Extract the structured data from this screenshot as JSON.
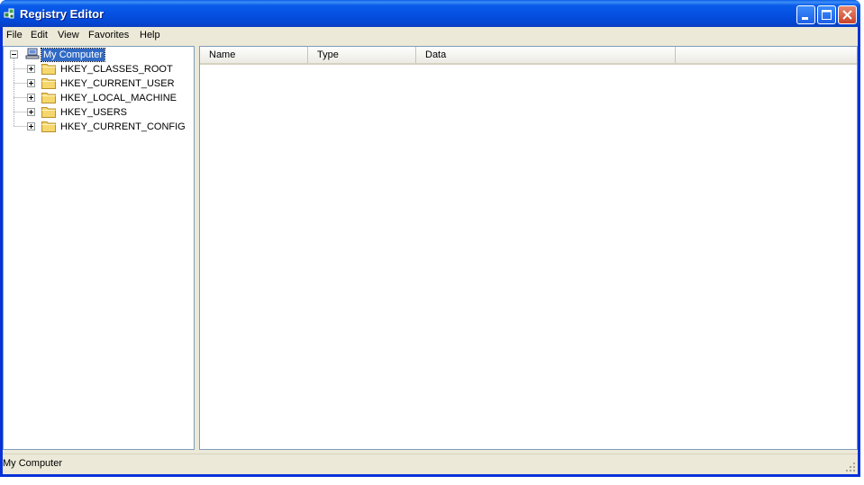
{
  "window": {
    "title": "Registry Editor",
    "icon": "registry-editor-icon",
    "controls": [
      "minimize-icon",
      "maximize-icon",
      "close-icon"
    ]
  },
  "menu": [
    "File",
    "Edit",
    "View",
    "Favorites",
    "Help"
  ],
  "tree": {
    "root": {
      "label": "My Computer",
      "icon": "computer-icon",
      "expanded": true,
      "selected": true
    },
    "children": [
      {
        "label": "HKEY_CLASSES_ROOT",
        "icon": "folder-icon",
        "expanded": false
      },
      {
        "label": "HKEY_CURRENT_USER",
        "icon": "folder-icon",
        "expanded": false
      },
      {
        "label": "HKEY_LOCAL_MACHINE",
        "icon": "folder-icon",
        "expanded": false
      },
      {
        "label": "HKEY_USERS",
        "icon": "folder-icon",
        "expanded": false
      },
      {
        "label": "HKEY_CURRENT_CONFIG",
        "icon": "folder-icon",
        "expanded": false
      }
    ]
  },
  "list": {
    "columns": [
      "Name",
      "Type",
      "Data"
    ],
    "rows": []
  },
  "status": {
    "text": "My Computer"
  },
  "colors": {
    "titlebar": "#0550e0",
    "selection": "#316ac5",
    "chrome": "#ece9d8",
    "folder": "#f5d76e"
  }
}
